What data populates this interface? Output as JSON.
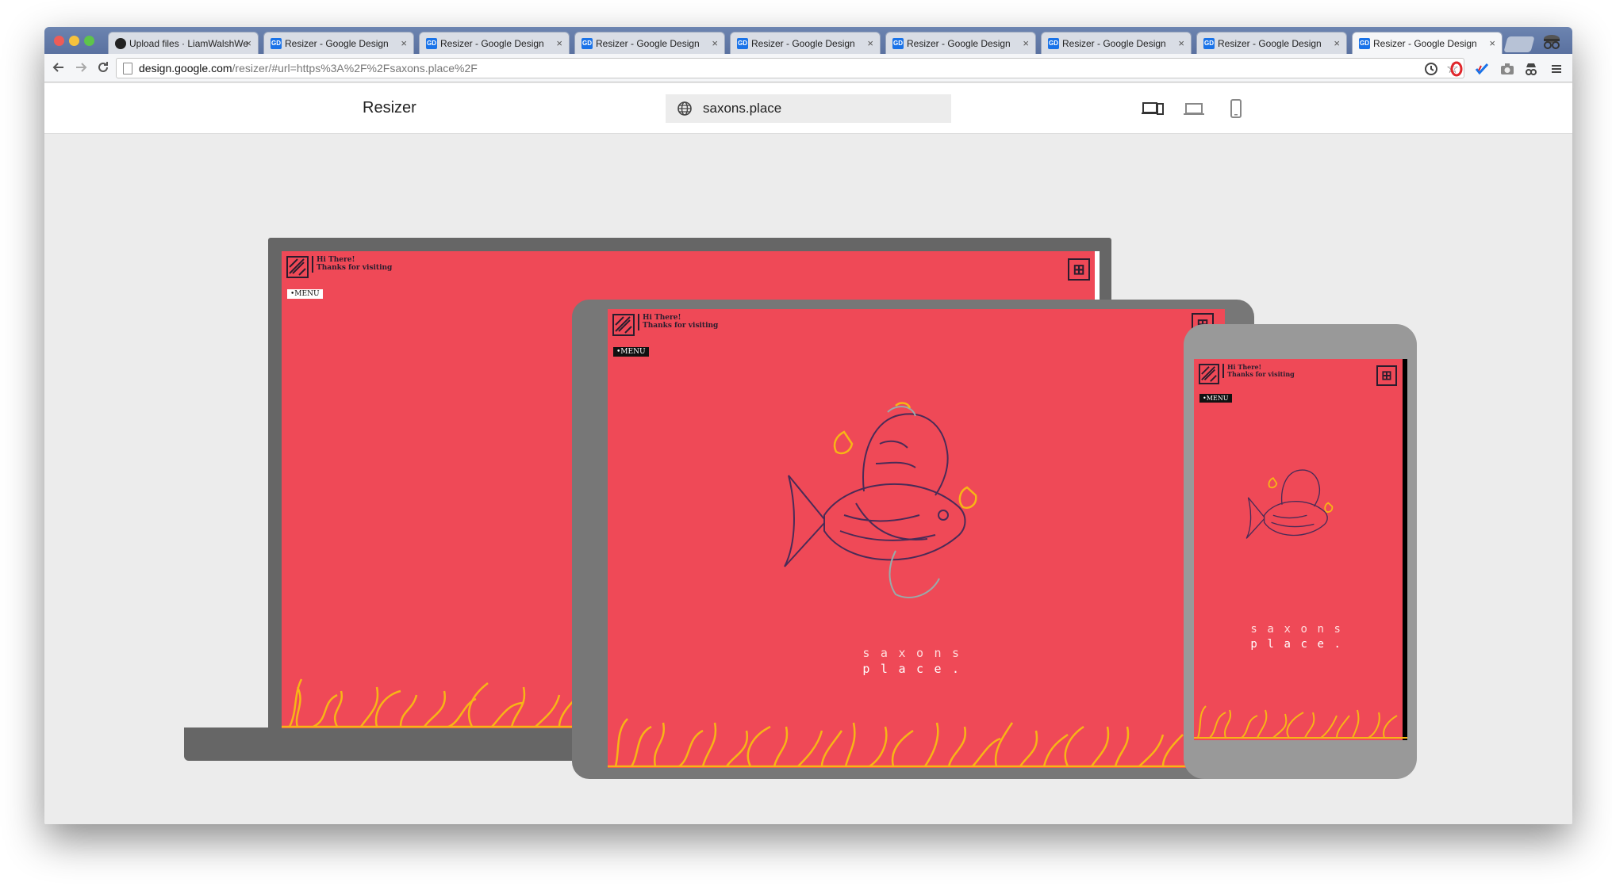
{
  "browser": {
    "tabs": [
      {
        "label": "Upload files · LiamWalshWe",
        "favicon": "github-icon",
        "active": false
      },
      {
        "label": "Resizer - Google Design",
        "favicon": "gd-icon",
        "active": false
      },
      {
        "label": "Resizer - Google Design",
        "favicon": "gd-icon",
        "active": false
      },
      {
        "label": "Resizer - Google Design",
        "favicon": "gd-icon",
        "active": false
      },
      {
        "label": "Resizer - Google Design",
        "favicon": "gd-icon",
        "active": false
      },
      {
        "label": "Resizer - Google Design",
        "favicon": "gd-icon",
        "active": false
      },
      {
        "label": "Resizer - Google Design",
        "favicon": "gd-icon",
        "active": false
      },
      {
        "label": "Resizer - Google Design",
        "favicon": "gd-icon",
        "active": false
      },
      {
        "label": "Resizer - Google Design",
        "favicon": "gd-icon",
        "active": true
      }
    ],
    "favicon_text": "GD",
    "tab_close": "×",
    "url_host": "design.google.com",
    "url_path": "/resizer/#url=https%3A%2F%2Fsaxons.place%2F"
  },
  "resizer": {
    "title": "Resizer",
    "url_value": "saxons.place",
    "device_buttons": [
      "responsive-icon",
      "laptop-icon",
      "phone-icon"
    ]
  },
  "site": {
    "greeting": "Hi There!",
    "subtitle": "Thanks for visiting",
    "menu_label": "•MENU",
    "brand_line1": "saxons",
    "brand_line2": "place.",
    "colors": {
      "background": "#ef4957",
      "coral": "#f7b516",
      "ink": "#2a1d2e"
    }
  }
}
